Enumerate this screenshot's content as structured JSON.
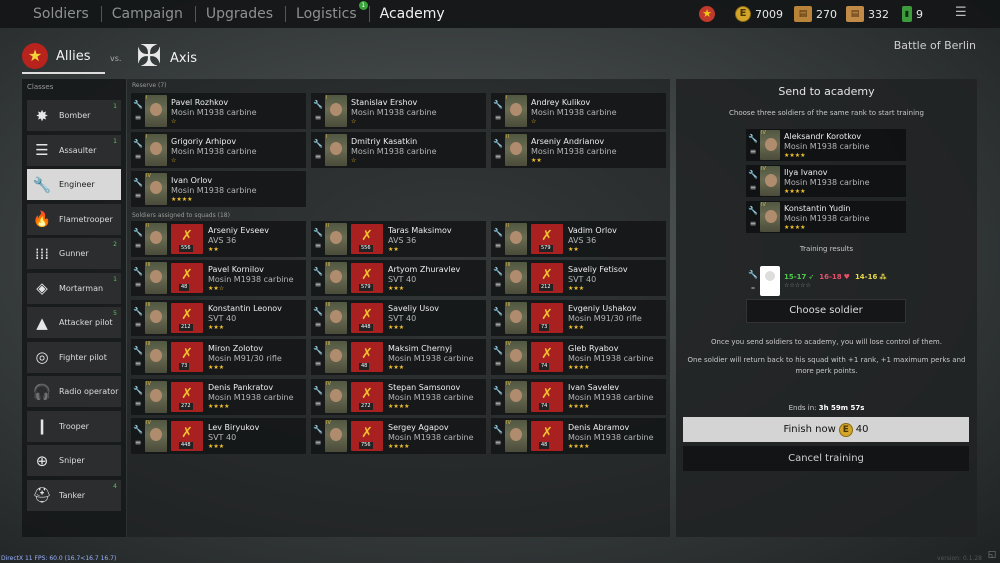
{
  "nav": {
    "tabs": [
      {
        "label": "Soldiers"
      },
      {
        "label": "Campaign"
      },
      {
        "label": "Upgrades"
      },
      {
        "label": "Logistics",
        "badge": "1"
      },
      {
        "label": "Academy"
      }
    ]
  },
  "resources": {
    "gold": "7009",
    "cards_a": "270",
    "cards_b": "332",
    "battery": "9"
  },
  "sides": {
    "allies": "Allies",
    "vs": "vs.",
    "axis": "Axis"
  },
  "battle": "Battle of Berlin",
  "classes": {
    "header": "Classes",
    "items": [
      {
        "label": "Bomber",
        "up": "1",
        "icon": "explosion-icon",
        "glyph": "✸"
      },
      {
        "label": "Assaulter",
        "up": "1",
        "icon": "clipboard-icon",
        "glyph": "☰"
      },
      {
        "label": "Engineer",
        "up": "",
        "icon": "wrench-icon",
        "glyph": "🔧"
      },
      {
        "label": "Flametrooper",
        "up": "",
        "icon": "flame-icon",
        "glyph": "🔥"
      },
      {
        "label": "Gunner",
        "up": "2",
        "icon": "ammo-icon",
        "glyph": "⁞⁞⁞"
      },
      {
        "label": "Mortarman",
        "up": "1",
        "icon": "mortar-icon",
        "glyph": "◈"
      },
      {
        "label": "Attacker pilot",
        "up": "5",
        "icon": "pilot-cap-icon",
        "glyph": "▲"
      },
      {
        "label": "Fighter pilot",
        "up": "",
        "icon": "goggles-icon",
        "glyph": "◎"
      },
      {
        "label": "Radio operator",
        "up": "",
        "icon": "headphones-icon",
        "glyph": "🎧"
      },
      {
        "label": "Trooper",
        "up": "",
        "icon": "bullet-icon",
        "glyph": "❙"
      },
      {
        "label": "Sniper",
        "up": "",
        "icon": "crosshair-icon",
        "glyph": "⊕"
      },
      {
        "label": "Tanker",
        "up": "4",
        "icon": "tank-helmet-icon",
        "glyph": "⛑"
      }
    ]
  },
  "reserve": {
    "header": "Reserve (7)",
    "cards": [
      {
        "name": "Pavel Rozhkov",
        "weapon": "Mosin M1938 carbine",
        "stars": "☆",
        "rank": "I"
      },
      {
        "name": "Stanislav Ershov",
        "weapon": "Mosin M1938 carbine",
        "stars": "☆",
        "rank": "I"
      },
      {
        "name": "Andrey Kulikov",
        "weapon": "Mosin M1938 carbine",
        "stars": "☆",
        "rank": "I"
      },
      {
        "name": "Grigoriy Arhipov",
        "weapon": "Mosin M1938 carbine",
        "stars": "☆",
        "rank": "I"
      },
      {
        "name": "Dmitriy Kasatkin",
        "weapon": "Mosin M1938 carbine",
        "stars": "☆",
        "rank": "I"
      },
      {
        "name": "Arseniy Andrianov",
        "weapon": "Mosin M1938 carbine",
        "stars": "★★",
        "rank": "II"
      },
      {
        "name": "Ivan Orlov",
        "weapon": "Mosin M1938 carbine",
        "stars": "★★★★",
        "rank": "IV"
      }
    ]
  },
  "assigned": {
    "header": "Soldiers assigned to squads (18)",
    "cards": [
      {
        "name": "Arseniy Evseev",
        "weapon": "AVS 36",
        "stars": "★★",
        "rank": "II",
        "squad": "556"
      },
      {
        "name": "Taras Maksimov",
        "weapon": "AVS 36",
        "stars": "★★",
        "rank": "II",
        "squad": "556"
      },
      {
        "name": "Vadim Orlov",
        "weapon": "AVS 36",
        "stars": "★★",
        "rank": "II",
        "squad": "579"
      },
      {
        "name": "Pavel Kornilov",
        "weapon": "Mosin M1938 carbine",
        "stars": "★★☆",
        "rank": "III",
        "squad": "48"
      },
      {
        "name": "Artyom Zhuravlev",
        "weapon": "SVT 40",
        "stars": "★★★",
        "rank": "III",
        "squad": "579"
      },
      {
        "name": "Saveliy Fetisov",
        "weapon": "SVT 40",
        "stars": "★★★",
        "rank": "III",
        "squad": "212"
      },
      {
        "name": "Konstantin Leonov",
        "weapon": "SVT 40",
        "stars": "★★★",
        "rank": "III",
        "squad": "212"
      },
      {
        "name": "Saveliy Usov",
        "weapon": "SVT 40",
        "stars": "★★★",
        "rank": "III",
        "squad": "448"
      },
      {
        "name": "Evgeniy Ushakov",
        "weapon": "Mosin M91/30 rifle",
        "stars": "★★★",
        "rank": "III",
        "squad": "73"
      },
      {
        "name": "Miron Zolotov",
        "weapon": "Mosin M91/30 rifle",
        "stars": "★★★",
        "rank": "III",
        "squad": "73"
      },
      {
        "name": "Maksim Chernyj",
        "weapon": "Mosin M1938 carbine",
        "stars": "★★★",
        "rank": "III",
        "squad": "48"
      },
      {
        "name": "Gleb Ryabov",
        "weapon": "Mosin M1938 carbine",
        "stars": "★★★★",
        "rank": "IV",
        "squad": "74"
      },
      {
        "name": "Denis Pankratov",
        "weapon": "Mosin M1938 carbine",
        "stars": "★★★★",
        "rank": "IV",
        "squad": "272"
      },
      {
        "name": "Stepan Samsonov",
        "weapon": "Mosin M1938 carbine",
        "stars": "★★★★",
        "rank": "IV",
        "squad": "272"
      },
      {
        "name": "Ivan Savelev",
        "weapon": "Mosin M1938 carbine",
        "stars": "★★★★",
        "rank": "IV",
        "squad": "74"
      },
      {
        "name": "Lev Biryukov",
        "weapon": "SVT 40",
        "stars": "★★★",
        "rank": "IV",
        "squad": "448"
      },
      {
        "name": "Sergey Agapov",
        "weapon": "Mosin M1938 carbine",
        "stars": "★★★★",
        "rank": "IV",
        "squad": "756"
      },
      {
        "name": "Denis Abramov",
        "weapon": "Mosin M1938 carbine",
        "stars": "★★★★",
        "rank": "IV",
        "squad": "48"
      }
    ]
  },
  "academy": {
    "title": "Send to academy",
    "subtitle": "Choose three soldiers of the same rank to start training",
    "training": [
      {
        "name": "Aleksandr Korotkov",
        "weapon": "Mosin M1938 carbine",
        "stars": "★★★★",
        "rank": "IV"
      },
      {
        "name": "Ilya Ivanov",
        "weapon": "Mosin M1938 carbine",
        "stars": "★★★★",
        "rank": "IV"
      },
      {
        "name": "Konstantin Yudin",
        "weapon": "Mosin M1938 carbine",
        "stars": "★★★★",
        "rank": "IV"
      }
    ],
    "results_header": "Training results",
    "result_a": "15-17",
    "result_b": "16-18",
    "result_c": "14-16",
    "result_stars": "☆☆☆☆☆",
    "choose_label": "Choose soldier",
    "info_1": "Once you send soldiers to academy, you will lose control of them.",
    "info_2": "One soldier will return back to his squad with +1 rank, +1 maximum perks and more perk points.",
    "ends_label": "Ends in:",
    "ends_value": "3h 59m 57s",
    "finish_label": "Finish now",
    "finish_cost": "40",
    "cancel_label": "Cancel training"
  },
  "footer": {
    "fps": "DirectX 11 FPS: 60.0 (16.7<16.7 16.7)",
    "version": "version: 0.1.28"
  },
  "colors": {
    "accent_red": "#a92020",
    "gold": "#d4a52b",
    "green": "#3aa53a"
  }
}
